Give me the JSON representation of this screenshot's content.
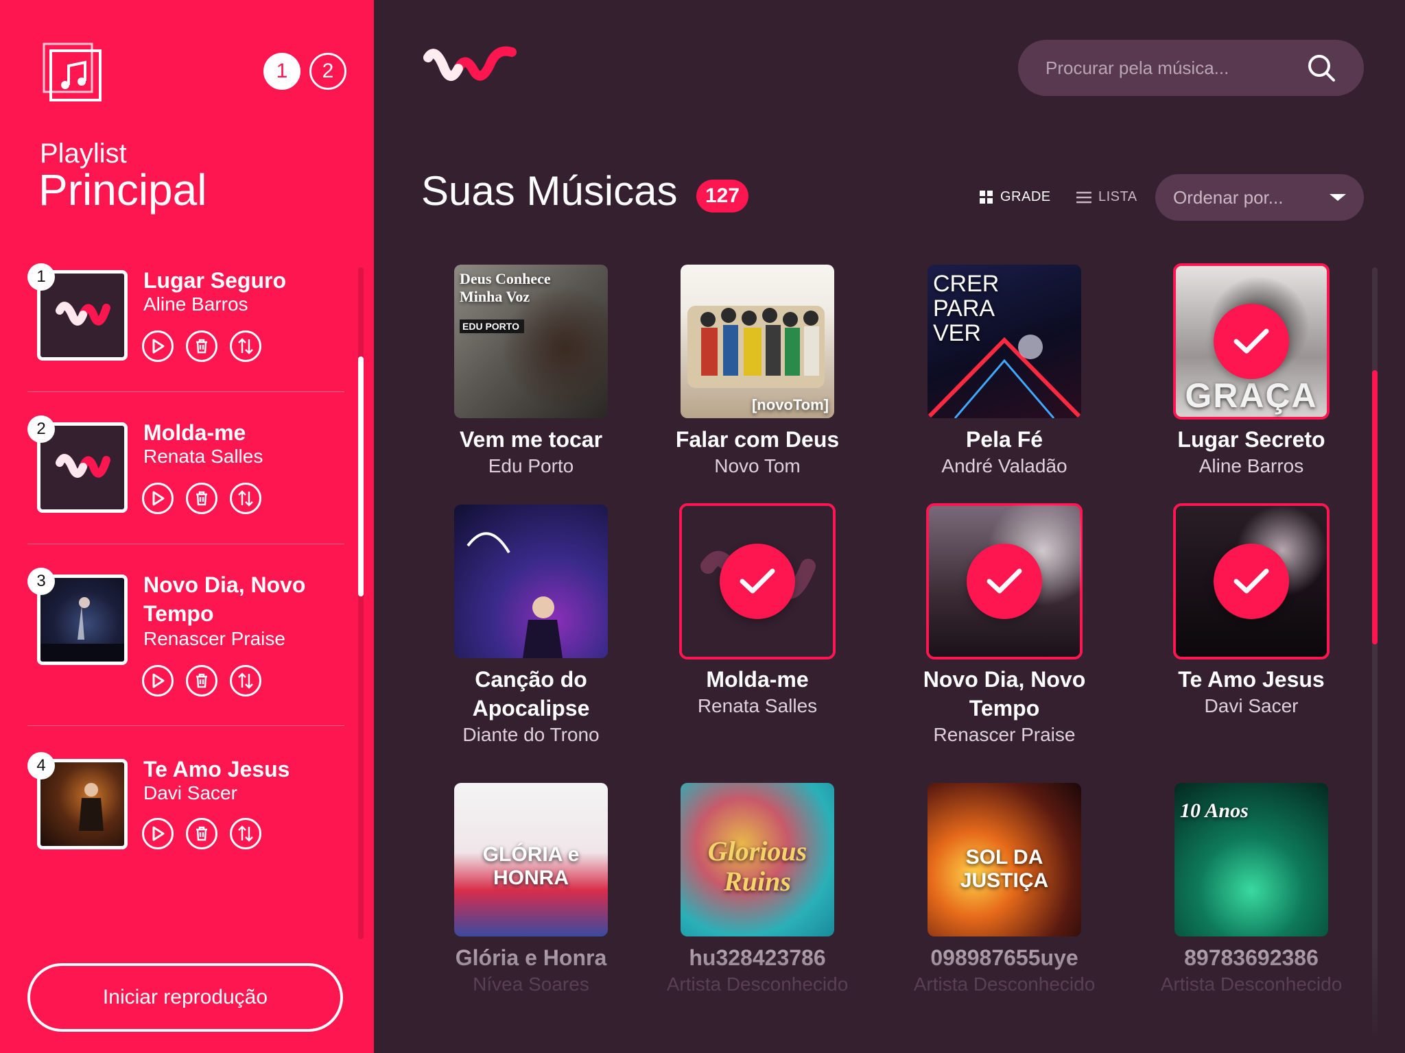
{
  "sidebar": {
    "pages": [
      "1",
      "2"
    ],
    "playlist_label": "Playlist",
    "playlist_name": "Principal",
    "queue": [
      {
        "num": "1",
        "title": "Lugar Seguro",
        "artist": "Aline Barros",
        "thumb": "logo"
      },
      {
        "num": "2",
        "title": "Molda-me",
        "artist": "Renata Salles",
        "thumb": "logo"
      },
      {
        "num": "3",
        "title": "Novo Dia, Novo Tempo",
        "artist": "Renascer Praise",
        "thumb": "renascer"
      },
      {
        "num": "4",
        "title": "Te Amo Jesus",
        "artist": "Davi Sacer",
        "thumb": "davi"
      }
    ],
    "start_label": "Iniciar reprodução"
  },
  "header": {
    "search_placeholder": "Procurar pela música...",
    "section_title": "Suas Músicas",
    "count": "127",
    "view_grid": "GRADE",
    "view_list": "LISTA",
    "sort_placeholder": "Ordenar por..."
  },
  "songs": [
    {
      "title": "Vem me tocar",
      "artist": "Edu Porto",
      "selected": false
    },
    {
      "title": "Falar com Deus",
      "artist": "Novo Tom",
      "selected": false
    },
    {
      "title": "Pela Fé",
      "artist": "André Valadão",
      "selected": false
    },
    {
      "title": "Lugar Secreto",
      "artist": "Aline Barros",
      "selected": true
    },
    {
      "title": "Canção do Apocalipse",
      "artist": "Diante do Trono",
      "selected": false
    },
    {
      "title": "Molda-me",
      "artist": "Renata Salles",
      "selected": true
    },
    {
      "title": "Novo Dia, Novo Tempo",
      "artist": "Renascer Praise",
      "selected": true
    },
    {
      "title": "Te Amo Jesus",
      "artist": "Davi Sacer",
      "selected": true
    },
    {
      "title": "Glória e Honra",
      "artist": "Nívea Soares",
      "selected": false
    },
    {
      "title": "hu328423786",
      "artist": "Artista Desconhecido",
      "selected": false
    },
    {
      "title": "098987655uye",
      "artist": "Artista Desconhecido",
      "selected": false
    },
    {
      "title": "89783692386",
      "artist": "Artista Desconhecido",
      "selected": false
    }
  ],
  "cover_texts": {
    "c0": "Deus Conhece Minha Voz",
    "c0b": "EDU PORTO",
    "c1": "[novoTom]",
    "c2": "CRER PARA VER",
    "c3": "GRAÇA",
    "c8": "GLÓRIA e HONRA",
    "c9": "Glorious Ruins",
    "c10": "SOL DA JUSTIÇA",
    "c11": "10 Anos"
  },
  "colors": {
    "accent": "#fe1650",
    "background": "#34202f",
    "panel": "#59394f"
  }
}
